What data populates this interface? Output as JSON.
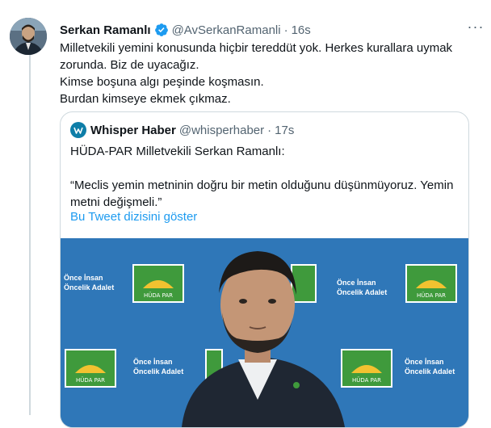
{
  "tweet": {
    "author_name": "Serkan Ramanlı",
    "handle": "@AvSerkanRamanli",
    "separator": "·",
    "time": "16s",
    "more_label": "···",
    "lines": [
      "Milletvekili yemini konusunda hiçbir tereddüt yok. Herkes kurallara uymak zorunda. Biz de uyacağız.",
      "Kimse boşuna algı peşinde koşmasın.",
      "Burdan kimseye ekmek çıkmaz."
    ]
  },
  "quote": {
    "author_name": "Whisper Haber",
    "handle": "@whisperhaber",
    "separator": "·",
    "time": "17s",
    "line1": "HÜDA-PAR Milletvekili Serkan Ramanlı:",
    "line2": "“Meclis yemin metninin doğru bir metin olduğunu düşünmüyoruz. Yemin metni değişmeli.”",
    "show_thread": "Bu Tweet dizisini göster"
  },
  "backdrop": {
    "slogan_line1": "Önce İnsan",
    "slogan_line2": "Öncelik Adalet",
    "logo_text": "HÜDA PAR"
  },
  "colors": {
    "link": "#1d9bf0",
    "verified": "#1d9bf0",
    "backdrop": "#2f77b8",
    "logo_green": "#3f9a3c"
  },
  "icons": {
    "verified": "verified-badge-icon",
    "more": "more-icon",
    "quote_avatar": "whisper-logo-icon"
  }
}
